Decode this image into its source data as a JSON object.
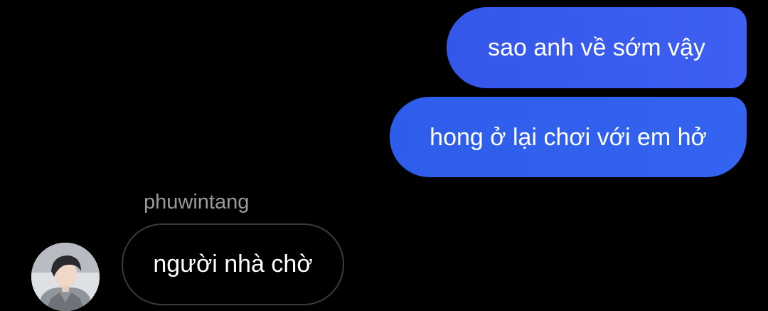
{
  "conversation": {
    "messages_out": [
      {
        "text": "sao anh về sớm vậy"
      },
      {
        "text": "hong ở lại chơi với em hở"
      }
    ],
    "incoming": {
      "sender": "phuwintang",
      "text": "người nhà chờ",
      "avatar_icon": "profile-avatar"
    }
  },
  "colors": {
    "background": "#000000",
    "outgoing_bubble": "#3a5ef0",
    "incoming_bubble_border": "#3a3a3a",
    "sender_text": "#9a9a9a",
    "message_text": "#ffffff"
  }
}
